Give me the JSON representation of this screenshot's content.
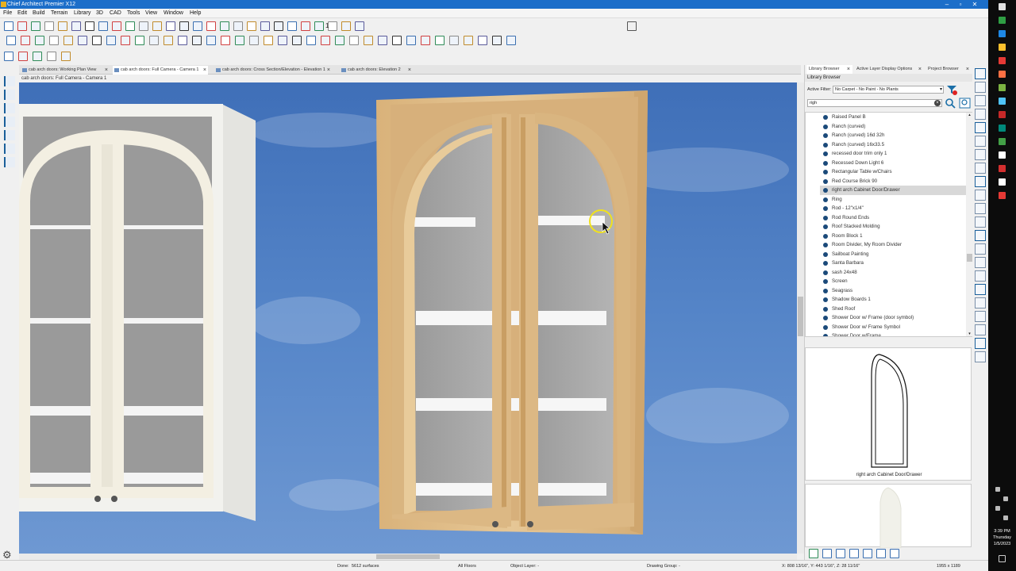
{
  "window": {
    "title": "Chief Architect Premier X12",
    "minimize": "–",
    "maximize": "▫",
    "close": "✕"
  },
  "menu": [
    "File",
    "Edit",
    "Build",
    "Terrain",
    "Library",
    "3D",
    "CAD",
    "Tools",
    "View",
    "Window",
    "Help"
  ],
  "toolbar": {
    "counter_value": "1"
  },
  "tabs": [
    {
      "label": "cab arch doors: Working Plan View"
    },
    {
      "label": "cab arch doors: Full Camera - Camera 1"
    },
    {
      "label": "cab arch doors: Cross Section/Elevation - Elevation 1"
    },
    {
      "label": "cab arch doors: Elevation 2"
    }
  ],
  "tab_close": "×",
  "view_title": "cab arch doors: Full Camera - Camera 1",
  "right_panel": {
    "tabs": [
      "Library Browser",
      "Active Layer Display Options",
      "Project Browser"
    ],
    "header": "Library Browser",
    "filter_label": "Active Filter:",
    "filter_value": "No Carpet - No Paint - No Plants",
    "search_value": "righ",
    "search_clear": "×",
    "items": [
      "Raised Panel B",
      "Ranch (curved)",
      "Ranch (curved) 16d 32h",
      "Ranch (curved) 16x33.5",
      "recessed door trim only 1",
      "Recessed Down Light 6",
      "Rectangular Table w/Chairs",
      "Red Course Brick 90",
      "right arch Cabinet Door/Drawer",
      "Ring",
      "Rod - 12\"x1/4\"",
      "Rod Round Ends",
      "Roof Stacked Molding",
      "Room Block 1",
      "Room Divider, My Room Divider",
      "Sailboat Painting",
      "Santa Barbara",
      "sash 24x48",
      "Screen",
      "Seagrass",
      "Shadow Boards 1",
      "Shed Roof",
      "Shower Door w/ Frame (door symbol)",
      "Shower Door w/ Frame Symbol",
      "Shower Door w/Frame"
    ],
    "selected_index": 8,
    "preview_caption": "right arch Cabinet Door/Drawer"
  },
  "status": {
    "done": "Done:",
    "surfaces": "5612 surfaces",
    "floors": "All Floors",
    "object_layer": "Object Layer: -",
    "drawing_group": "Drawing Group: -",
    "coords": "X: 808 13/16\", Y: 443 1/16\", Z: 28 11/16\"",
    "size": "1955 x 1189"
  },
  "clock": {
    "time": "3:39 PM",
    "day": "Thursday",
    "date": "1/5/2023"
  },
  "colors": {
    "title_bar": "#1c6ec9",
    "sky": "#4d7ec3",
    "wood": "#dcb985",
    "cabinet_white": "#f2f2ee",
    "list_dot": "#1b4a7a"
  }
}
